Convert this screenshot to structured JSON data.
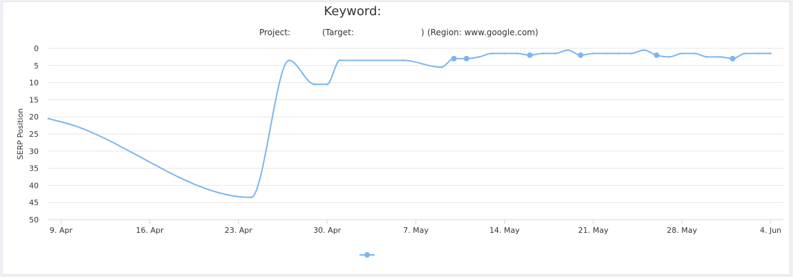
{
  "chart_data": {
    "type": "line",
    "title": "Keyword:",
    "subtitle_project_label": "Project:",
    "subtitle_target_label": "(Target:",
    "subtitle_target_close": ")",
    "subtitle_region": "(Region: www.google.com)",
    "ylabel": "SERP Position",
    "ylim": [
      0,
      50
    ],
    "y_reversed": true,
    "yticks": [
      0,
      5,
      10,
      15,
      20,
      25,
      30,
      35,
      40,
      45,
      50
    ],
    "xlim": [
      "2017-04-08",
      "2017-06-05"
    ],
    "xticks": [
      {
        "date": "2017-04-09",
        "label": "9. Apr"
      },
      {
        "date": "2017-04-16",
        "label": "16. Apr"
      },
      {
        "date": "2017-04-23",
        "label": "23. Apr"
      },
      {
        "date": "2017-04-30",
        "label": "30. Apr"
      },
      {
        "date": "2017-05-07",
        "label": "7. May"
      },
      {
        "date": "2017-05-14",
        "label": "14. May"
      },
      {
        "date": "2017-05-21",
        "label": "21. May"
      },
      {
        "date": "2017-05-28",
        "label": "28. May"
      },
      {
        "date": "2017-06-04",
        "label": "4. Jun"
      }
    ],
    "grid": true,
    "legend": "bottom-center",
    "line_color": "#7cb5ec",
    "grid_color": "#e6e6e6",
    "series": [
      {
        "name": "",
        "points": [
          {
            "x": "2017-04-08",
            "y": 20.5
          },
          {
            "x": "2017-04-10",
            "y": 22.5
          },
          {
            "x": "2017-04-24",
            "y": 43.5
          },
          {
            "x": "2017-04-27",
            "y": 3.5
          },
          {
            "x": "2017-04-29",
            "y": 10.5
          },
          {
            "x": "2017-04-30",
            "y": 10.5
          },
          {
            "x": "2017-05-01",
            "y": 3.5
          },
          {
            "x": "2017-05-06",
            "y": 3.5
          },
          {
            "x": "2017-05-09",
            "y": 5.5
          },
          {
            "x": "2017-05-10",
            "y": 3,
            "marker": true
          },
          {
            "x": "2017-05-11",
            "y": 3,
            "marker": true
          },
          {
            "x": "2017-05-12",
            "y": 2.5
          },
          {
            "x": "2017-05-13",
            "y": 1.5
          },
          {
            "x": "2017-05-14",
            "y": 1.5
          },
          {
            "x": "2017-05-15",
            "y": 1.5
          },
          {
            "x": "2017-05-16",
            "y": 2,
            "marker": true
          },
          {
            "x": "2017-05-17",
            "y": 1.5
          },
          {
            "x": "2017-05-18",
            "y": 1.5
          },
          {
            "x": "2017-05-19",
            "y": 0.5
          },
          {
            "x": "2017-05-20",
            "y": 2,
            "marker": true
          },
          {
            "x": "2017-05-21",
            "y": 1.5
          },
          {
            "x": "2017-05-22",
            "y": 1.5
          },
          {
            "x": "2017-05-23",
            "y": 1.5
          },
          {
            "x": "2017-05-24",
            "y": 1.5
          },
          {
            "x": "2017-05-25",
            "y": 0.5
          },
          {
            "x": "2017-05-26",
            "y": 2,
            "marker": true
          },
          {
            "x": "2017-05-27",
            "y": 2.5
          },
          {
            "x": "2017-05-28",
            "y": 1.5
          },
          {
            "x": "2017-05-29",
            "y": 1.5
          },
          {
            "x": "2017-05-30",
            "y": 2.5
          },
          {
            "x": "2017-05-31",
            "y": 2.5
          },
          {
            "x": "2017-06-01",
            "y": 3,
            "marker": true
          },
          {
            "x": "2017-06-02",
            "y": 1.5
          },
          {
            "x": "2017-06-03",
            "y": 1.5
          },
          {
            "x": "2017-06-04",
            "y": 1.5
          }
        ]
      }
    ]
  }
}
